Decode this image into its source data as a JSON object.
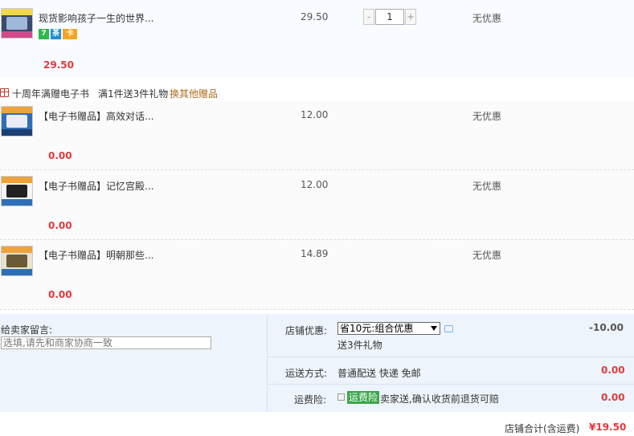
{
  "main_item": {
    "title": "现货影响孩子一生的世界...",
    "price": "29.50",
    "quantity": "1",
    "discount": "无优惠",
    "subtotal": "29.50",
    "badges": [
      "7",
      "茶",
      "卡"
    ]
  },
  "promo": {
    "line1": "十周年满赠电子书",
    "line2": "满1件送3件礼物",
    "change_link": "换其他赠品"
  },
  "gifts": [
    {
      "title": "【电子书赠品】高效对话...",
      "price": "12.00",
      "discount": "无优惠",
      "subtotal": "0.00"
    },
    {
      "title": "【电子书赠品】记忆宫殿...",
      "price": "12.00",
      "discount": "无优惠",
      "subtotal": "0.00"
    },
    {
      "title": "【电子书赠品】明朝那些...",
      "price": "14.89",
      "discount": "无优惠",
      "subtotal": "0.00"
    }
  ],
  "footer": {
    "message_label": "给卖家留言:",
    "message_placeholder": "选填,请先和商家协商一致",
    "shop_discount_label": "店铺优惠:",
    "shop_discount_selected": "省10元:组合优惠",
    "shop_discount_note": "送3件礼物",
    "shop_discount_value": "-10.00",
    "shipping_label": "运送方式:",
    "shipping_method": "普通配送 快递 免邮",
    "shipping_fee": "0.00",
    "insurance_label": "运费险:",
    "insurance_tag": "运费险",
    "insurance_text": "卖家送,确认收货前退货可赔",
    "insurance_fee": "0.00",
    "total_label": "店铺合计(含运费)",
    "total_value": "¥19.50"
  },
  "colors": {
    "price_red": "#e4393c",
    "insurance_green": "#3aa64a",
    "link_brown": "#b06a1e",
    "footer_bg": "#eef4fb"
  },
  "icons": {
    "gift": "gift-icon",
    "chat": "chat-icon",
    "checkbox": "checkbox-icon"
  }
}
